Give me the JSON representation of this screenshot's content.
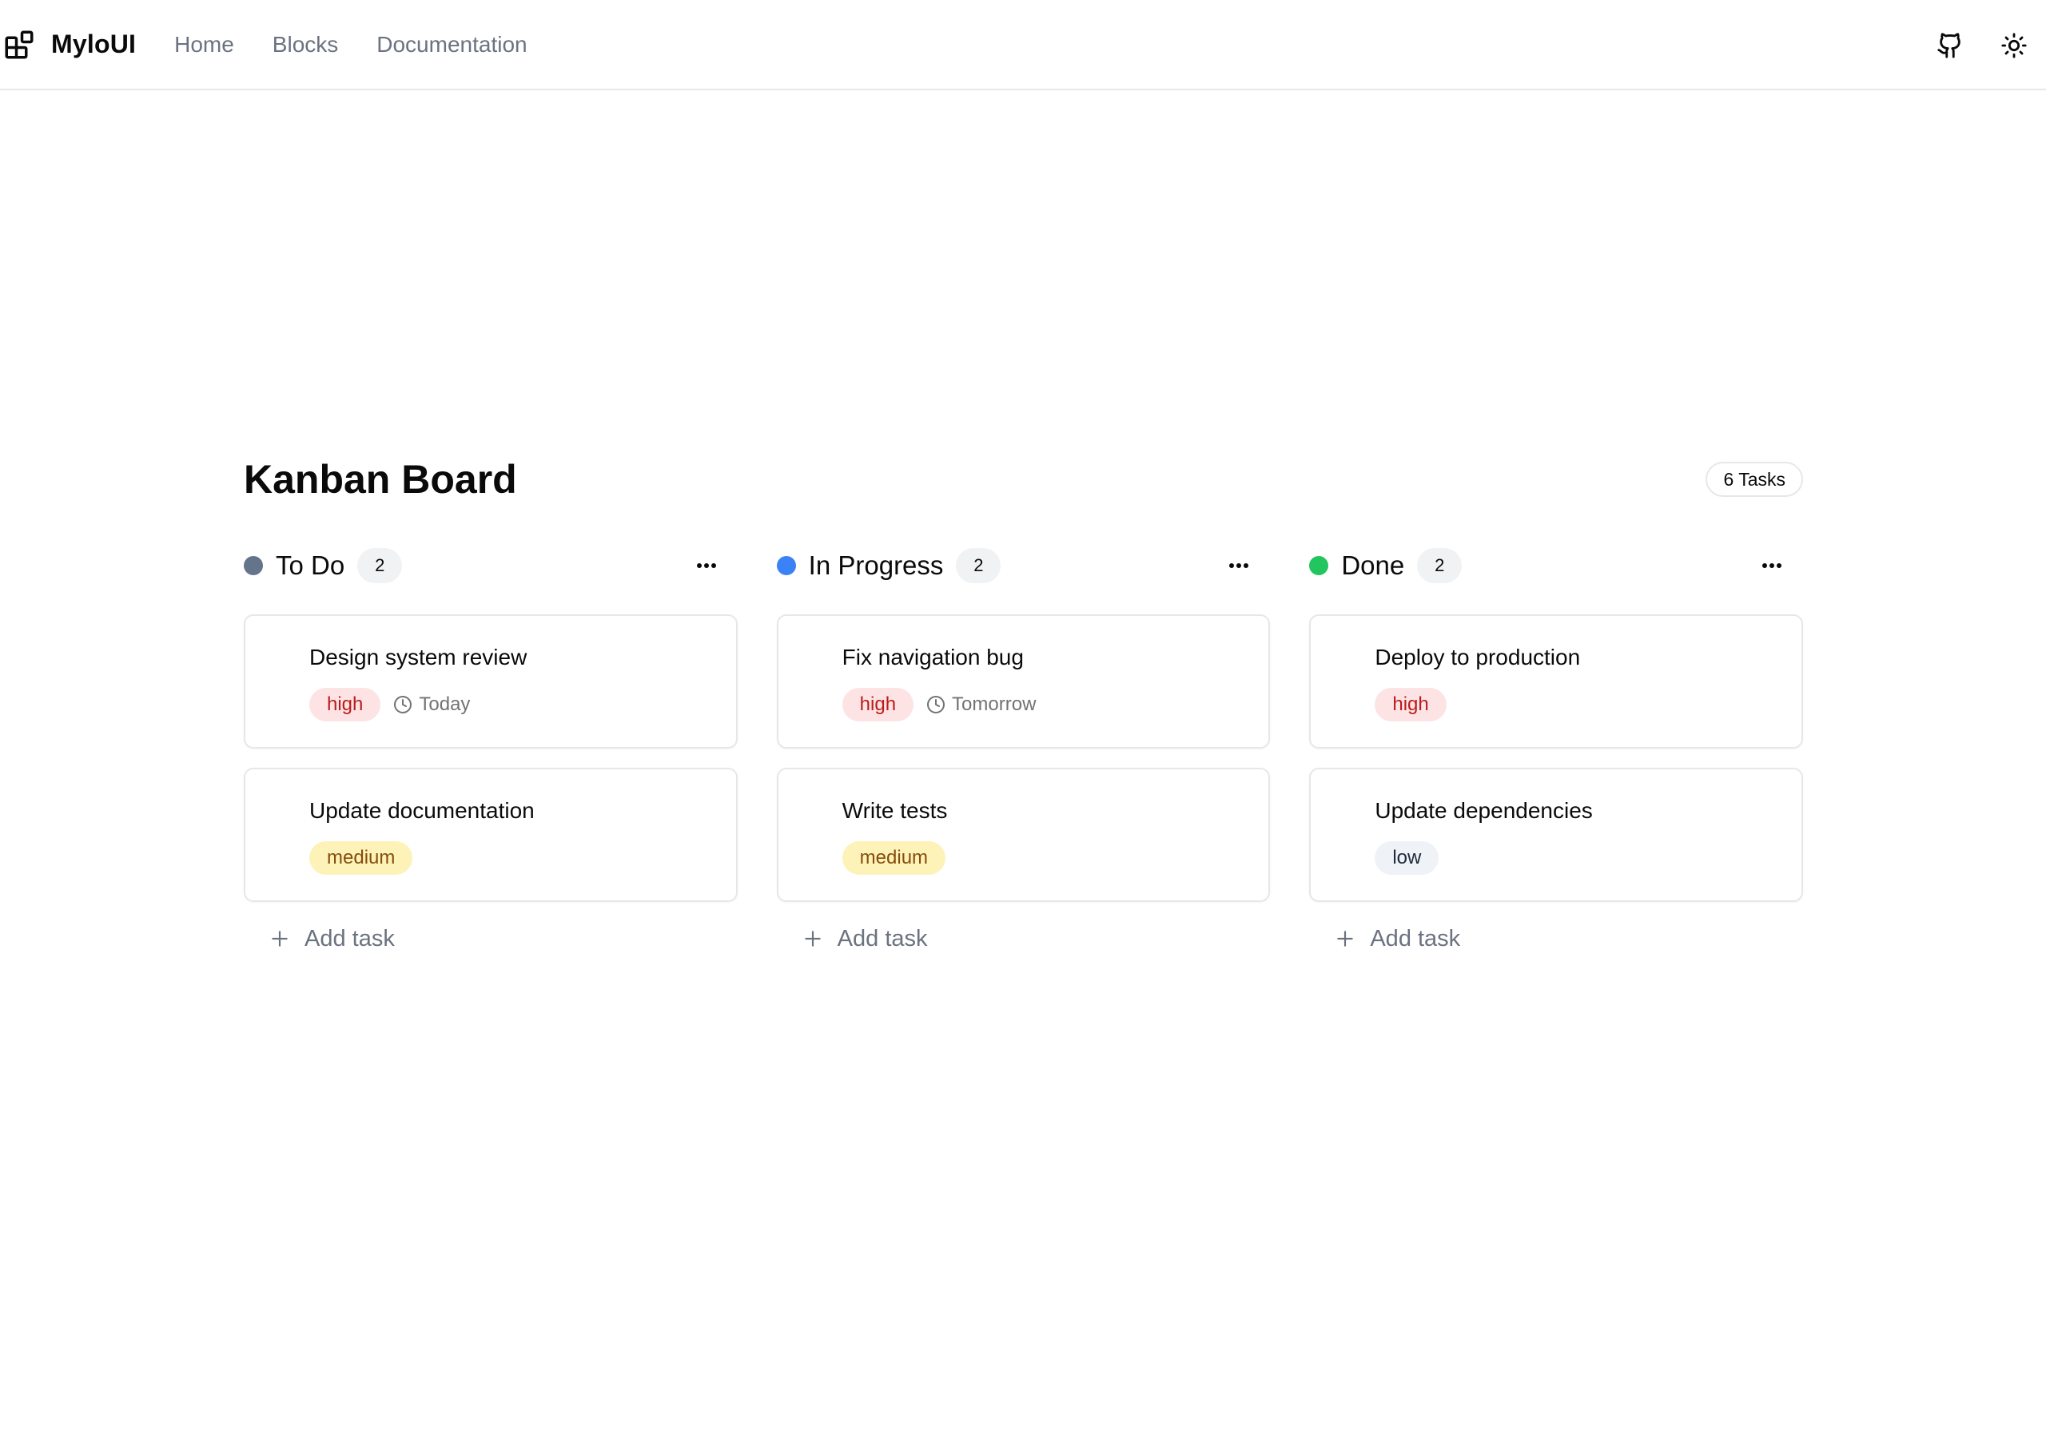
{
  "header": {
    "brand": "MyloUI",
    "nav": [
      "Home",
      "Blocks",
      "Documentation"
    ]
  },
  "board": {
    "title": "Kanban Board",
    "task_count": "6 Tasks",
    "add_task_label": "Add task",
    "columns": [
      {
        "title": "To Do",
        "count": "2",
        "color": "#64748b",
        "cards": [
          {
            "title": "Design system review",
            "priority": "high",
            "due": "Today"
          },
          {
            "title": "Update documentation",
            "priority": "medium"
          }
        ]
      },
      {
        "title": "In Progress",
        "count": "2",
        "color": "#3b82f6",
        "cards": [
          {
            "title": "Fix navigation bug",
            "priority": "high",
            "due": "Tomorrow"
          },
          {
            "title": "Write tests",
            "priority": "medium"
          }
        ]
      },
      {
        "title": "Done",
        "count": "2",
        "color": "#22c55e",
        "cards": [
          {
            "title": "Deploy to production",
            "priority": "high"
          },
          {
            "title": "Update dependencies",
            "priority": "low"
          }
        ]
      }
    ]
  },
  "icons": {
    "brand": "blocks-icon",
    "github": "github-icon",
    "theme": "sun-icon",
    "more": "more-horizontal-icon",
    "due": "clock-icon",
    "add": "plus-icon"
  }
}
